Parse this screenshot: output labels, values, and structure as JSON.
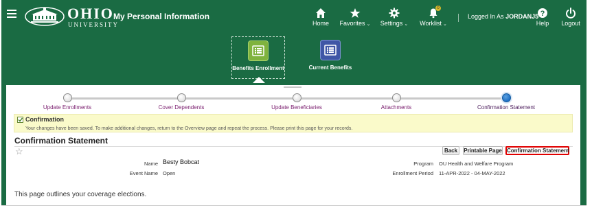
{
  "header": {
    "brand": "OHIO",
    "brand_sub": "UNIVERSITY",
    "app_title": "My Personal Information",
    "nav": {
      "home": "Home",
      "favorites": "Favorites",
      "settings": "Settings",
      "worklist": "Worklist",
      "worklist_badge": "0",
      "help": "Help",
      "logout": "Logout"
    },
    "logged_in_prefix": "Logged In As",
    "username": "JORDANJ5"
  },
  "tiles": [
    {
      "label": "Benefits Enrollment",
      "selected": true
    },
    {
      "label": "Current Benefits",
      "selected": false
    }
  ],
  "train": {
    "steps": [
      {
        "label": "Update Enrollments"
      },
      {
        "label": "Cover Dependents"
      },
      {
        "label": "Update Beneficiaries"
      },
      {
        "label": "Attachments"
      },
      {
        "label": "Confirmation Statement",
        "current": true
      }
    ]
  },
  "confirmation": {
    "title": "Confirmation",
    "message": "Your changes have been saved. To make additional changes, return to the Overview page and repeat the process. Please print this page for your records."
  },
  "page": {
    "heading": "Confirmation Statement",
    "buttons": {
      "back": "Back",
      "printable": "Printable Page",
      "confirmation": "Confirmation Statement"
    },
    "fields": {
      "name_label": "Name",
      "name_value": "Besty Bobcat",
      "event_label": "Event Name",
      "event_value": "Open",
      "program_label": "Program",
      "program_value": "OU Health and Welfare Program",
      "period_label": "Enrollment Period",
      "period_value": "11-APR-2022 - 04-MAY-2022"
    },
    "outline_text": "This page outlines your coverage elections."
  },
  "colors": {
    "brand_green": "#1a6b43",
    "train_link": "#7a1d6e",
    "highlight_border": "#e00000",
    "info_bg": "#fafaca"
  }
}
